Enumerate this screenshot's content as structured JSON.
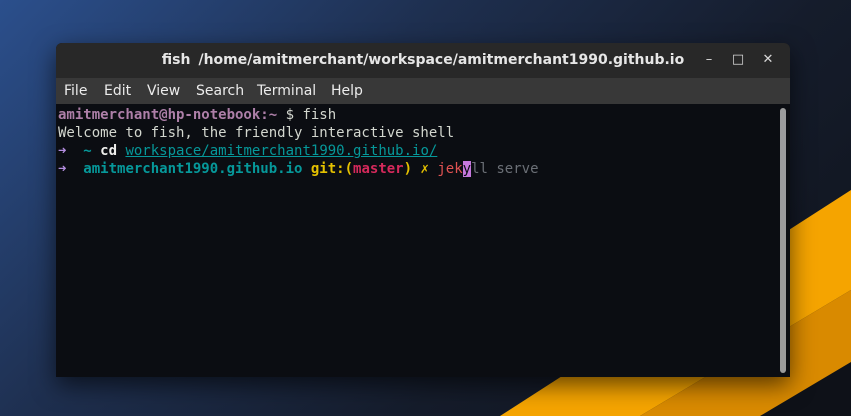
{
  "window": {
    "title_app": "fish",
    "title_path": "/home/amitmerchant/workspace/amitmerchant1990.github.io",
    "controls": {
      "minimize": "–",
      "maximize": "□",
      "close": "✕"
    }
  },
  "menu": [
    "File",
    "Edit",
    "View",
    "Search",
    "Terminal",
    "Help"
  ],
  "terminal": {
    "line1": {
      "user_host": "amitmerchant@hp-notebook",
      "path_sep": ":~",
      "prompt": " $ ",
      "command": "fish"
    },
    "line2": "Welcome to fish, the friendly interactive shell",
    "line3": {
      "arrow": "➜",
      "tilde": "  ~ ",
      "cmd": "cd ",
      "arg": "workspace/amitmerchant1990.github.io/"
    },
    "line4": {
      "arrow": "➜",
      "dir": "  amitmerchant1990.github.io ",
      "git_label": "git:(",
      "branch": "master",
      "git_close": ")",
      "dirty": " ✗ ",
      "typed": "jek",
      "cursor_char": "y",
      "suggestion": "ll serve"
    }
  },
  "colors": {
    "accent_orange": "#f5a400",
    "purple": "#ad7fa8",
    "teal": "#06989a",
    "yellow": "#e5c100",
    "red": "#d5295b"
  }
}
